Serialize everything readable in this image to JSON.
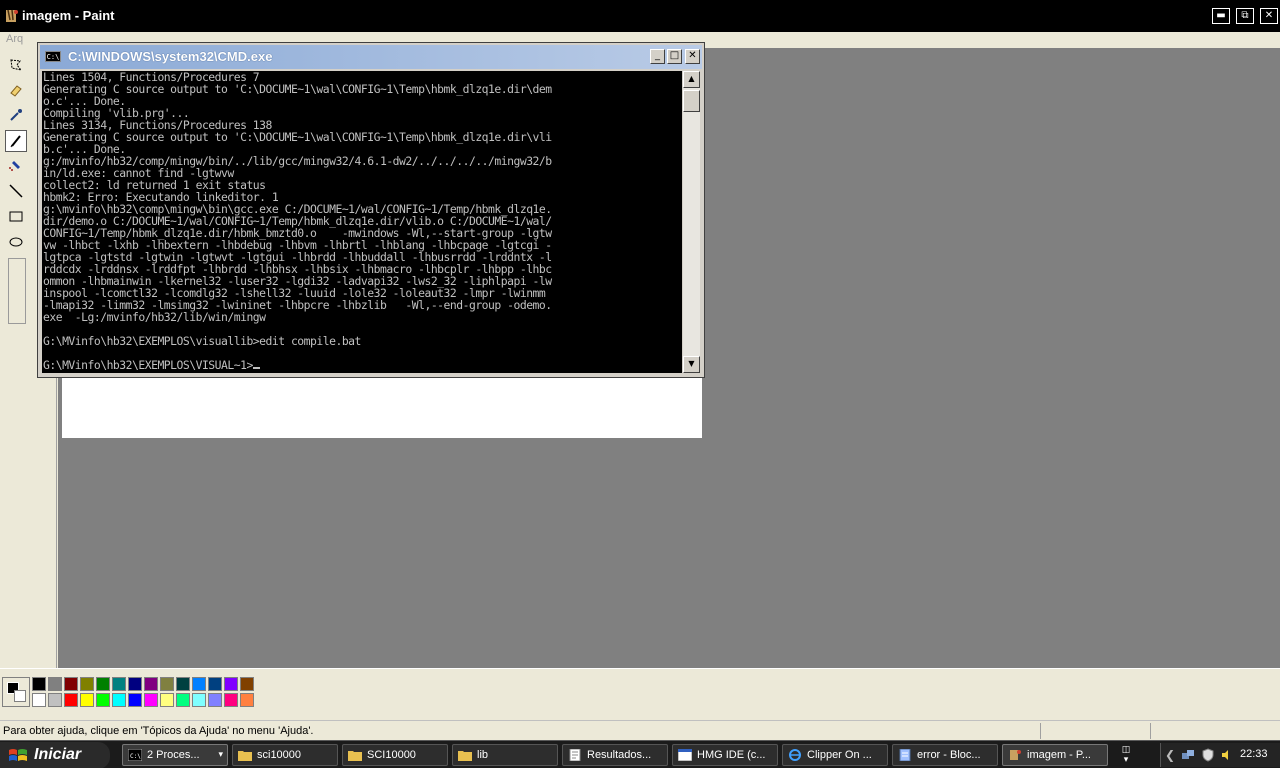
{
  "paint": {
    "title": "imagem - Paint",
    "menu_partial": "Arq",
    "status_text": "Para obter ajuda, clique em 'Tópicos da Ajuda' no menu 'Ajuda'.",
    "tools": [
      "free-select-icon",
      "eraser-icon",
      "eyedropper-icon",
      "pencil-icon",
      "airbrush-icon",
      "line-icon",
      "rectangle-icon",
      "ellipse-icon"
    ],
    "palette_top": [
      "#000000",
      "#808080",
      "#800000",
      "#808000",
      "#008000",
      "#008080",
      "#000080",
      "#800080",
      "#808040",
      "#004040",
      "#0080ff",
      "#004080",
      "#8000ff",
      "#804000"
    ],
    "palette_bottom": [
      "#ffffff",
      "#c0c0c0",
      "#ff0000",
      "#ffff00",
      "#00ff00",
      "#00ffff",
      "#0000ff",
      "#ff00ff",
      "#ffff80",
      "#00ff80",
      "#80ffff",
      "#8080ff",
      "#ff0080",
      "#ff8040"
    ]
  },
  "cmd": {
    "title": "C:\\WINDOWS\\system32\\CMD.exe",
    "lines": [
      "Lines 1504, Functions/Procedures 7",
      "Generating C source output to 'C:\\DOCUME~1\\wal\\CONFIG~1\\Temp\\hbmk_dlzq1e.dir\\dem",
      "o.c'... Done.",
      "Compiling 'vlib.prg'...",
      "Lines 3134, Functions/Procedures 138",
      "Generating C source output to 'C:\\DOCUME~1\\wal\\CONFIG~1\\Temp\\hbmk_dlzq1e.dir\\vli",
      "b.c'... Done.",
      "g:/mvinfo/hb32/comp/mingw/bin/../lib/gcc/mingw32/4.6.1-dw2/../../../../mingw32/b",
      "in/ld.exe: cannot find -lgtwvw",
      "collect2: ld returned 1 exit status",
      "hbmk2: Erro: Executando linkeditor. 1",
      "g:\\mvinfo\\hb32\\comp\\mingw\\bin\\gcc.exe C:/DOCUME~1/wal/CONFIG~1/Temp/hbmk_dlzq1e.",
      "dir/demo.o C:/DOCUME~1/wal/CONFIG~1/Temp/hbmk_dlzq1e.dir/vlib.o C:/DOCUME~1/wal/",
      "CONFIG~1/Temp/hbmk_dlzq1e.dir/hbmk_bmztd0.o    -mwindows -Wl,--start-group -lgtw",
      "vw -lhbct -lxhb -lhbextern -lhbdebug -lhbvm -lhbrtl -lhblang -lhbcpage -lgtcgi -",
      "lgtpca -lgtstd -lgtwin -lgtwvt -lgtgui -lhbrdd -lhbuddall -lhbusrrdd -lrddntx -l",
      "rddcdx -lrddnsx -lrddfpt -lhbrdd -lhbhsx -lhbsix -lhbmacro -lhbcplr -lhbpp -lhbc",
      "ommon -lhbmainwin -lkernel32 -luser32 -lgdi32 -ladvapi32 -lws2_32 -liphlpapi -lw",
      "inspool -lcomctl32 -lcomdlg32 -lshell32 -luuid -lole32 -loleaut32 -lmpr -lwinmm",
      "-lmapi32 -limm32 -lmsimg32 -lwininet -lhbpcre -lhbzlib   -Wl,--end-group -odemo.",
      "exe  -Lg:/mvinfo/hb32/lib/win/mingw",
      "",
      "G:\\MVinfo\\hb32\\EXEMPLOS\\visuallib>edit compile.bat",
      "",
      "G:\\MVinfo\\hb32\\EXEMPLOS\\VISUAL~1>"
    ]
  },
  "taskbar": {
    "start_label": "Iniciar",
    "items": [
      {
        "label": "2 Proces...",
        "icon": "cmd-icon"
      },
      {
        "label": "sci10000",
        "icon": "folder-icon"
      },
      {
        "label": "SCI10000",
        "icon": "folder-icon"
      },
      {
        "label": "lib",
        "icon": "folder-icon"
      },
      {
        "label": "Resultados...",
        "icon": "document-icon"
      },
      {
        "label": "HMG IDE (c...",
        "icon": "window-icon"
      },
      {
        "label": "Clipper On ...",
        "icon": "ie-icon"
      },
      {
        "label": "error - Bloc...",
        "icon": "notepad-icon"
      },
      {
        "label": "imagem - P...",
        "icon": "paint-icon"
      }
    ],
    "clock": "22:33"
  }
}
